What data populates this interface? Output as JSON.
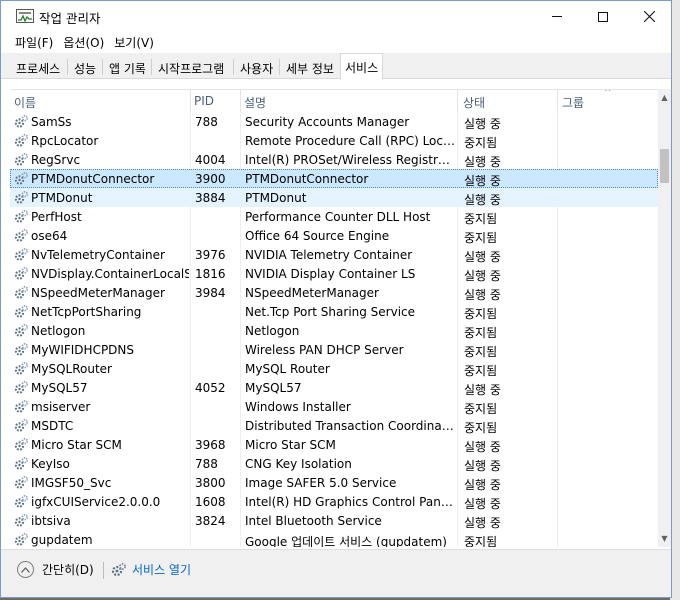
{
  "window": {
    "title": "작업 관리자",
    "menu": [
      "파일(F)",
      "옵션(O)",
      "보기(V)"
    ]
  },
  "tabs": [
    "프로세스",
    "성능",
    "앱 기록",
    "시작프로그램",
    "사용자",
    "세부 정보",
    "서비스"
  ],
  "active_tab": "서비스",
  "columns": {
    "name": "이름",
    "pid": "PID",
    "description": "설명",
    "status": "상태",
    "group": "그룹"
  },
  "services": [
    {
      "name": "SamSs",
      "pid": "788",
      "description": "Security Accounts Manager",
      "status": "실행 중"
    },
    {
      "name": "RpcLocator",
      "pid": "",
      "description": "Remote Procedure Call (RPC) Locator",
      "status": "중지됨"
    },
    {
      "name": "RegSrvc",
      "pid": "4004",
      "description": "Intel(R) PROSet/Wireless Registry Ser...",
      "status": "실행 중"
    },
    {
      "name": "PTMDonutConnector",
      "pid": "3900",
      "description": "PTMDonutConnector",
      "status": "실행 중",
      "state": "selected"
    },
    {
      "name": "PTMDonut",
      "pid": "3884",
      "description": "PTMDonut",
      "status": "실행 중",
      "state": "hover"
    },
    {
      "name": "PerfHost",
      "pid": "",
      "description": "Performance Counter DLL Host",
      "status": "중지됨"
    },
    {
      "name": "ose64",
      "pid": "",
      "description": "Office 64 Source Engine",
      "status": "중지됨"
    },
    {
      "name": "NvTelemetryContainer",
      "pid": "3976",
      "description": "NVIDIA Telemetry Container",
      "status": "실행 중"
    },
    {
      "name": "NVDisplay.ContainerLocalS...",
      "pid": "1816",
      "description": "NVIDIA Display Container LS",
      "status": "실행 중"
    },
    {
      "name": "NSpeedMeterManager",
      "pid": "3984",
      "description": "NSpeedMeterManager",
      "status": "실행 중"
    },
    {
      "name": "NetTcpPortSharing",
      "pid": "",
      "description": "Net.Tcp Port Sharing Service",
      "status": "중지됨"
    },
    {
      "name": "Netlogon",
      "pid": "",
      "description": "Netlogon",
      "status": "중지됨"
    },
    {
      "name": "MyWIFIDHCPDNS",
      "pid": "",
      "description": "Wireless PAN DHCP Server",
      "status": "중지됨"
    },
    {
      "name": "MySQLRouter",
      "pid": "",
      "description": "MySQL Router",
      "status": "중지됨"
    },
    {
      "name": "MySQL57",
      "pid": "4052",
      "description": "MySQL57",
      "status": "실행 중"
    },
    {
      "name": "msiserver",
      "pid": "",
      "description": "Windows Installer",
      "status": "중지됨"
    },
    {
      "name": "MSDTC",
      "pid": "",
      "description": "Distributed Transaction Coordinator",
      "status": "중지됨"
    },
    {
      "name": "Micro Star SCM",
      "pid": "3968",
      "description": "Micro Star SCM",
      "status": "실행 중"
    },
    {
      "name": "KeyIso",
      "pid": "788",
      "description": "CNG Key Isolation",
      "status": "실행 중"
    },
    {
      "name": "IMGSF50_Svc",
      "pid": "3800",
      "description": "Image SAFER 5.0 Service",
      "status": "실행 중"
    },
    {
      "name": "igfxCUIService2.0.0.0",
      "pid": "1608",
      "description": "Intel(R) HD Graphics Control Panel ...",
      "status": "실행 중"
    },
    {
      "name": "ibtsiva",
      "pid": "3824",
      "description": "Intel Bluetooth Service",
      "status": "실행 중"
    },
    {
      "name": "gupdatem",
      "pid": "",
      "description": "Google 업데이트 서비스 (gupdatem)",
      "status": "중지됨"
    }
  ],
  "footer": {
    "fewer_details": "간단히(D)",
    "open_services": "서비스 열기"
  },
  "icons": {
    "app": "task-manager-icon",
    "service": "gear-icon",
    "fewer": "chevron-up-circle-icon",
    "open_services": "services-gear-icon"
  },
  "colors": {
    "selected_row": "#cce8ff",
    "hover_row": "#e5f3ff",
    "link": "#0066cc",
    "header_text": "#4c607a"
  }
}
